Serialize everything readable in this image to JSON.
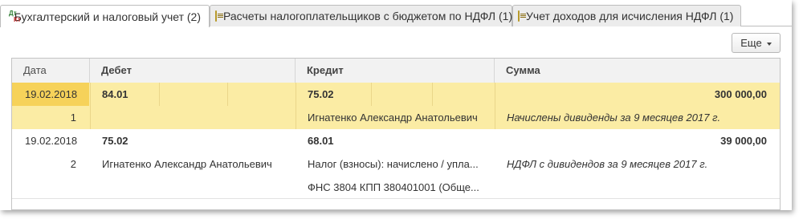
{
  "tabs": [
    {
      "label": "Бухгалтерский и налоговый учет (2)",
      "icon": "dt-kt-icon",
      "active": true
    },
    {
      "label": "Расчеты налогоплательщиков с бюджетом по НДФЛ (1)",
      "icon": "register-doc-icon",
      "active": false
    },
    {
      "label": "Учет доходов для исчисления НДФЛ (1)",
      "icon": "register-doc-icon",
      "active": false
    }
  ],
  "tab_icon": {
    "dt": "Дт",
    "kt": "Кт"
  },
  "toolbar": {
    "more_label": "Еще"
  },
  "columns": {
    "date": "Дата",
    "debit": "Дебет",
    "credit": "Кредит",
    "amount": "Сумма"
  },
  "entries": [
    {
      "date": "19.02.2018",
      "line_no": "1",
      "debit_account": "84.01",
      "debit_subconto": "",
      "credit_account": "75.02",
      "credit_subconto_1": "Игнатенко Александр Анатольевич",
      "credit_subconto_2": "",
      "amount": "300 000,00",
      "content": "Начислены дивиденды за 9 месяцев 2017 г.",
      "selected": true
    },
    {
      "date": "19.02.2018",
      "line_no": "2",
      "debit_account": "75.02",
      "debit_subconto": "Игнатенко Александр Анатольевич",
      "credit_account": "68.01",
      "credit_subconto_1": "Налог (взносы): начислено / упла...",
      "credit_subconto_2": "ФНС 3804 КПП 380401001 (Обще...",
      "amount": "39 000,00",
      "content": "НДФЛ с дивидендов за 9 месяцев 2017 г.",
      "selected": false
    }
  ],
  "colors": {
    "selection": "#fbeca4",
    "selection_cell": "#f6d25a",
    "header": "#f2f2f2"
  }
}
